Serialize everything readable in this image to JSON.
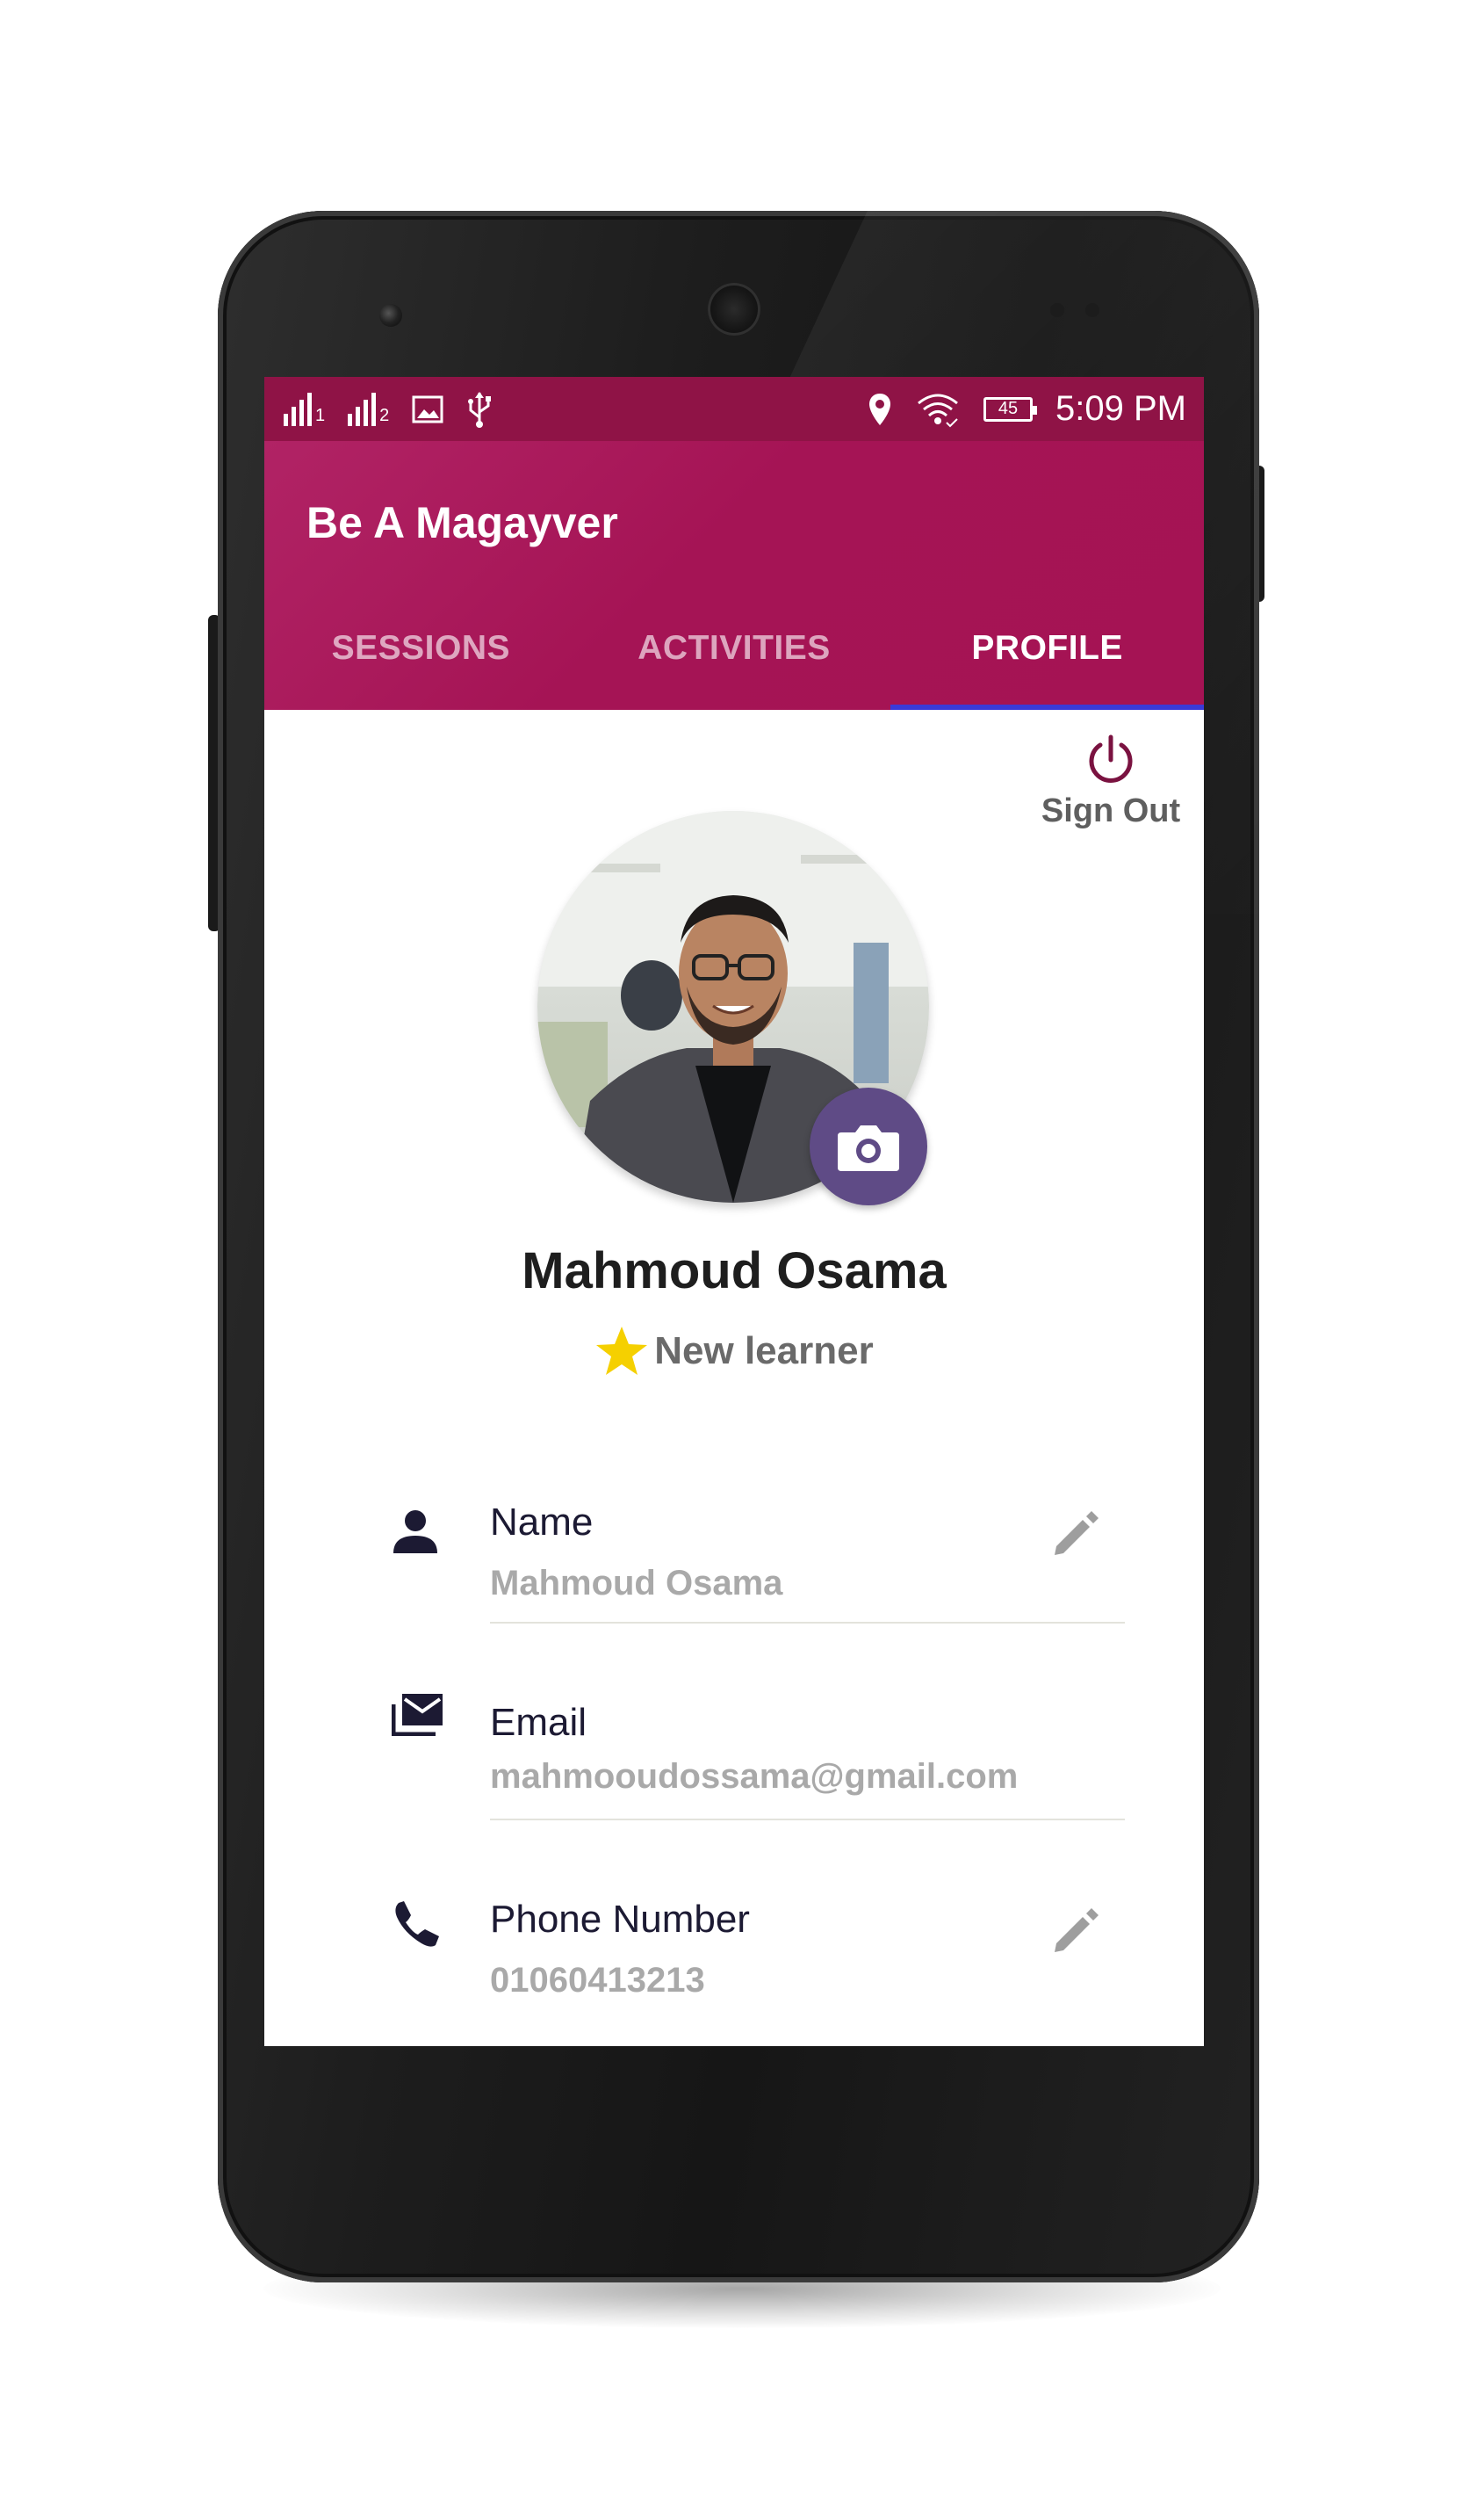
{
  "status_bar": {
    "sim1": "1",
    "sim2": "2",
    "battery": "45",
    "time": "5:09 PM",
    "icons": [
      "signal-icon",
      "image-icon",
      "usb-icon",
      "location-icon",
      "wifi-icon",
      "battery-icon"
    ]
  },
  "app": {
    "title": "Be A Magayver",
    "tabs": [
      {
        "label": "SESSIONS",
        "active": false
      },
      {
        "label": "ACTIVITIES",
        "active": false
      },
      {
        "label": "PROFILE",
        "active": true
      }
    ]
  },
  "profile": {
    "sign_out_label": "Sign Out",
    "name": "Mahmoud Osama",
    "level": "New learner",
    "fields": [
      {
        "label": "Name",
        "value": "Mahmoud Osama",
        "icon": "person-icon",
        "editable": true
      },
      {
        "label": "Email",
        "value": "mahmooudossama@gmail.com",
        "icon": "email-icon",
        "editable": false
      },
      {
        "label": "Phone Number",
        "value": "01060413213",
        "icon": "phone-icon",
        "editable": true
      }
    ]
  },
  "colors": {
    "status_bar": "#8f1346",
    "app_bar": "#a51455",
    "tab_indicator": "#3a3ad8",
    "camera_button": "#5f4b86",
    "sign_out_icon": "#7a1240",
    "star": "#f5d000",
    "icon_dark": "#1c1a33"
  }
}
